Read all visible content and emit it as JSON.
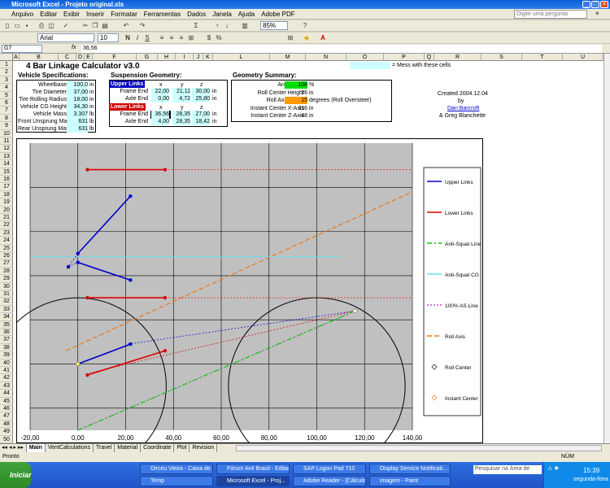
{
  "window": {
    "title": "Microsoft Excel - Projeto original.xls"
  },
  "menu": [
    "Arquivo",
    "Editar",
    "Exibir",
    "Inserir",
    "Formatar",
    "Ferramentas",
    "Dados",
    "Janela",
    "Ajuda",
    "Adobe PDF"
  ],
  "help_box": {
    "placeholder": "Digite uma pergunta"
  },
  "toolbar": {
    "font": "Arial",
    "size": "10",
    "zoom": "85%"
  },
  "formula": {
    "cell_ref": "G7",
    "fx": "fx",
    "value": "36,56"
  },
  "columns": [
    "A",
    "B",
    "C",
    "D",
    "E",
    "F",
    "G",
    "H",
    "I",
    "J",
    "K",
    "L",
    "M",
    "N",
    "O",
    "P",
    "Q",
    "R",
    "S",
    "T",
    "U"
  ],
  "rows": [
    "1",
    "2",
    "3",
    "4",
    "5",
    "6",
    "7",
    "8",
    "9",
    "10",
    "11",
    "12",
    "13",
    "14",
    "15",
    "16",
    "17",
    "18",
    "19",
    "20",
    "21",
    "22",
    "23",
    "24",
    "25",
    "26",
    "27",
    "28",
    "29",
    "30",
    "31",
    "32",
    "33",
    "34",
    "35",
    "36",
    "37",
    "38",
    "39",
    "40",
    "41",
    "42",
    "43",
    "44",
    "45",
    "46",
    "47",
    "48",
    "49",
    "50"
  ],
  "sheet": {
    "title": "4 Bar Linkage Calculator v3.0",
    "mess_note": "= Mess with these cells",
    "vehicle_header": "Vehicle Specifications:",
    "vehicle": [
      {
        "label": "Wheelbase",
        "value": "100,0",
        "unit": "in"
      },
      {
        "label": "Tire Diameter",
        "value": "37,00",
        "unit": "in"
      },
      {
        "label": "Tire Rolling Radius",
        "value": "18,00",
        "unit": "in"
      },
      {
        "label": "Vehicle CG Height",
        "value": "34,30",
        "unit": "in"
      },
      {
        "label": "Vehicle Mass",
        "value": "3.307",
        "unit": "lb"
      },
      {
        "label": "Front Unsprung Mass",
        "value": "631",
        "unit": "lb"
      },
      {
        "label": "Rear Unsprung Mass",
        "value": "631",
        "unit": "lb"
      }
    ],
    "susp_header": "Suspension Geometry:",
    "upper_links": "Upper Links",
    "lower_links": "Lower Links",
    "x": "x",
    "y": "y",
    "z": "z",
    "upper": [
      {
        "label": "Frame End",
        "x": "22,00",
        "y": "21,11",
        "z": "30,00",
        "unit": "in"
      },
      {
        "label": "Axle End",
        "x": "0,00",
        "y": "4,72",
        "z": "25,80",
        "unit": "in"
      }
    ],
    "lower": [
      {
        "label": "Frame End",
        "x": "36,56",
        "y": "28,35",
        "z": "27,00",
        "unit": "in"
      },
      {
        "label": "Axle End",
        "x": "4,00",
        "y": "28,35",
        "z": "18,42",
        "unit": "in"
      }
    ],
    "geom_header": "Geometry Summary:",
    "geom": [
      {
        "label": "Anti-Squat",
        "value": "108",
        "unit": "%"
      },
      {
        "label": "Roll Center Height",
        "value": "26",
        "unit": "in"
      },
      {
        "label": "Roll Axis Angle",
        "value": "15",
        "unit": "degrees (Roll Oversteer)"
      },
      {
        "label": "Instant Center X-Axis",
        "value": "116",
        "unit": "in"
      },
      {
        "label": "Instant Center Z-Axis",
        "value": "48",
        "unit": "in"
      }
    ],
    "credits": {
      "created": "Created 2004.12.04",
      "by": "by",
      "author1": "Dan Barcroft",
      "author2": "& Greg Blanchette"
    }
  },
  "chart_data": {
    "type": "scatter",
    "x_ticks": [
      "-20,00",
      "0,00",
      "20,00",
      "40,00",
      "60,00",
      "80,00",
      "100,00",
      "120,00",
      "140,00"
    ],
    "xlim": [
      -20,
      140
    ],
    "legend": [
      "Upper Links",
      "Lower Links",
      "Anti-Squat Line",
      "Anti-Squat CG",
      "100% AS Line",
      "Roll Axis",
      "Roll Center",
      "Instant Center"
    ],
    "colors": {
      "upper": "#0000cc",
      "lower": "#dd0000",
      "antisquat": "#00cc00",
      "antisquat_cg": "#66ddee",
      "as100": "#cc44cc",
      "roll": "#ee7711"
    }
  },
  "tabs": [
    "Main",
    "VentCalculations",
    "Travel",
    "Material",
    "Coordinate",
    "Plot",
    "Revision"
  ],
  "status": {
    "left": "Pronto",
    "right": "NÚM"
  },
  "taskbar": {
    "start": "Iniciar",
    "tasks": [
      "Dirceu Vieira - Caixa de e...",
      "Fórum 4x4 Brasil - Editar ...",
      "SAP Logon Pad 710",
      "Display Service Notificati...",
      "Temp",
      "Microsoft Excel - Proj...",
      "Adobe Reader - [Cálculo ...",
      "imagem - Paint"
    ],
    "search": "Pesquisar na Área de",
    "time": "15:39",
    "day": "segunda-feira"
  }
}
